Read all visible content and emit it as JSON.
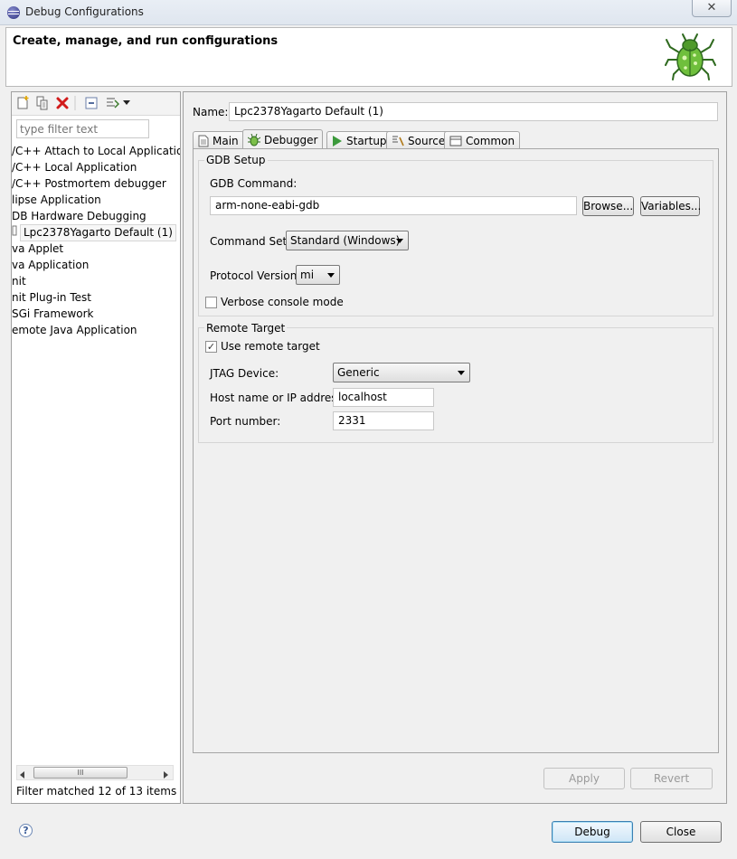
{
  "window": {
    "title": "Debug Configurations",
    "close_glyph": "✕"
  },
  "header": {
    "title": "Create, manage, and run configurations"
  },
  "left": {
    "filter_placeholder": "type filter text",
    "tree": [
      "/C++ Attach to Local Application",
      "/C++ Local Application",
      "/C++ Postmortem debugger",
      "lipse Application",
      "DB Hardware Debugging",
      "va Applet",
      "va Application",
      "nit",
      "nit Plug-in Test",
      "SGi Framework",
      "emote Java Application"
    ],
    "selected_child": "Lpc2378Yagarto Default (1)",
    "scroll_grip": "III",
    "status": "Filter matched 12 of 13 items"
  },
  "config": {
    "name_label": "Name:",
    "name_value": "Lpc2378Yagarto Default (1)",
    "tabs": [
      "Main",
      "Debugger",
      "Startup",
      "Source",
      "Common"
    ],
    "active_tab": "Debugger"
  },
  "gdb": {
    "group_label": "GDB Setup",
    "command_label": "GDB Command:",
    "command_value": "arm-none-eabi-gdb",
    "browse": "Browse...",
    "variables": "Variables...",
    "command_set_label": "Command Set:",
    "command_set_value": "Standard (Windows)",
    "protocol_label": "Protocol Version:",
    "protocol_value": "mi",
    "verbose_label": "Verbose console mode",
    "verbose_checked": false
  },
  "remote": {
    "group_label": "Remote Target",
    "use_remote_label": "Use remote target",
    "use_remote_checked": true,
    "check_glyph": "✓",
    "jtag_label": "JTAG Device:",
    "jtag_value": "Generic",
    "host_label": "Host name or IP address:",
    "host_value": "localhost",
    "port_label": "Port number:",
    "port_value": "2331"
  },
  "actions": {
    "apply": "Apply",
    "revert": "Revert",
    "debug": "Debug",
    "close": "Close",
    "help": "?"
  }
}
